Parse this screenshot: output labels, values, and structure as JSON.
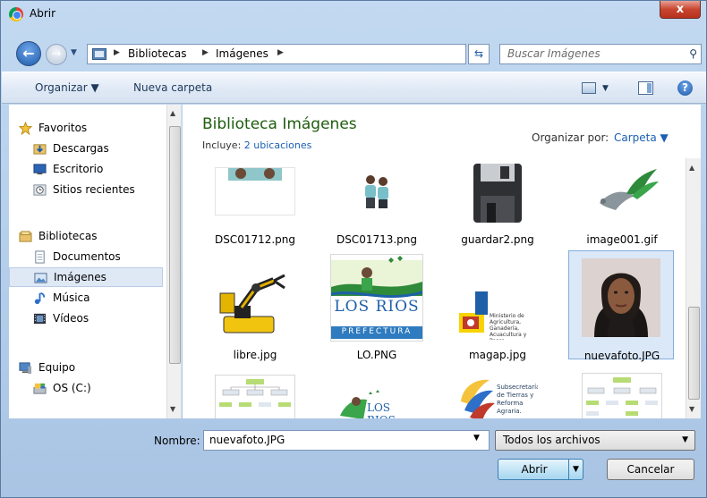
{
  "window": {
    "title": "Abrir",
    "close_glyph": "x"
  },
  "address": {
    "crumbs": [
      "Bibliotecas",
      "Imágenes"
    ],
    "search_placeholder": "Buscar Imágenes"
  },
  "toolbar": {
    "organize": "Organizar ▼",
    "new_folder": "Nueva carpeta"
  },
  "nav": {
    "favorites_label": "Favoritos",
    "favorites": [
      "Descargas",
      "Escritorio",
      "Sitios recientes"
    ],
    "libraries_label": "Bibliotecas",
    "libraries": [
      "Documentos",
      "Imágenes",
      "Música",
      "Vídeos"
    ],
    "selected": "Imágenes",
    "computer_label": "Equipo",
    "computer": [
      "OS (C:)"
    ]
  },
  "content": {
    "title": "Biblioteca Imágenes",
    "includes_prefix": "Incluye:",
    "includes_link": "2 ubicaciones",
    "arrange_label": "Organizar por:",
    "arrange_value": "Carpeta ▼",
    "files": [
      {
        "name": "DSC01712.png",
        "icon": "people-photo-icon"
      },
      {
        "name": "DSC01713.png",
        "icon": "people-photo-icon"
      },
      {
        "name": "guardar2.png",
        "icon": "floppy-disk-icon"
      },
      {
        "name": "image001.gif",
        "icon": "dove-logo-icon"
      },
      {
        "name": "libre.jpg",
        "icon": "robot-arm-icon"
      },
      {
        "name": "LO.PNG",
        "icon": "los-rios-logo-icon"
      },
      {
        "name": "magap.jpg",
        "icon": "magap-logo-icon"
      },
      {
        "name": "nuevafoto.JPG",
        "icon": "portrait-photo-icon"
      },
      {
        "name": "",
        "icon": "diagram-thumb-icon"
      },
      {
        "name": "",
        "icon": "los-rios-logo-icon"
      },
      {
        "name": "",
        "icon": "subsecretaria-logo-icon"
      },
      {
        "name": "",
        "icon": "diagram-thumb-icon"
      }
    ],
    "selected_file": "nuevafoto.JPG"
  },
  "logos": {
    "los_rios": "LOS RIOS",
    "prefectura": "PREFECTURA",
    "magap_text": "Ministerio de Agricultura, Ganadería, Acuacultura y Pesca",
    "subsecretaria": "Subsecretaría de Tierras y Reforma Agraria."
  },
  "footer": {
    "name_label": "Nombre:",
    "name_value": "nuevafoto.JPG",
    "filter_value": "Todos los archivos",
    "open_button": "Abrir",
    "cancel_button": "Cancelar"
  },
  "colors": {
    "title_green": "#1e5d0e",
    "link_blue": "#1a5fb4",
    "selection": "#dbe8f7"
  }
}
